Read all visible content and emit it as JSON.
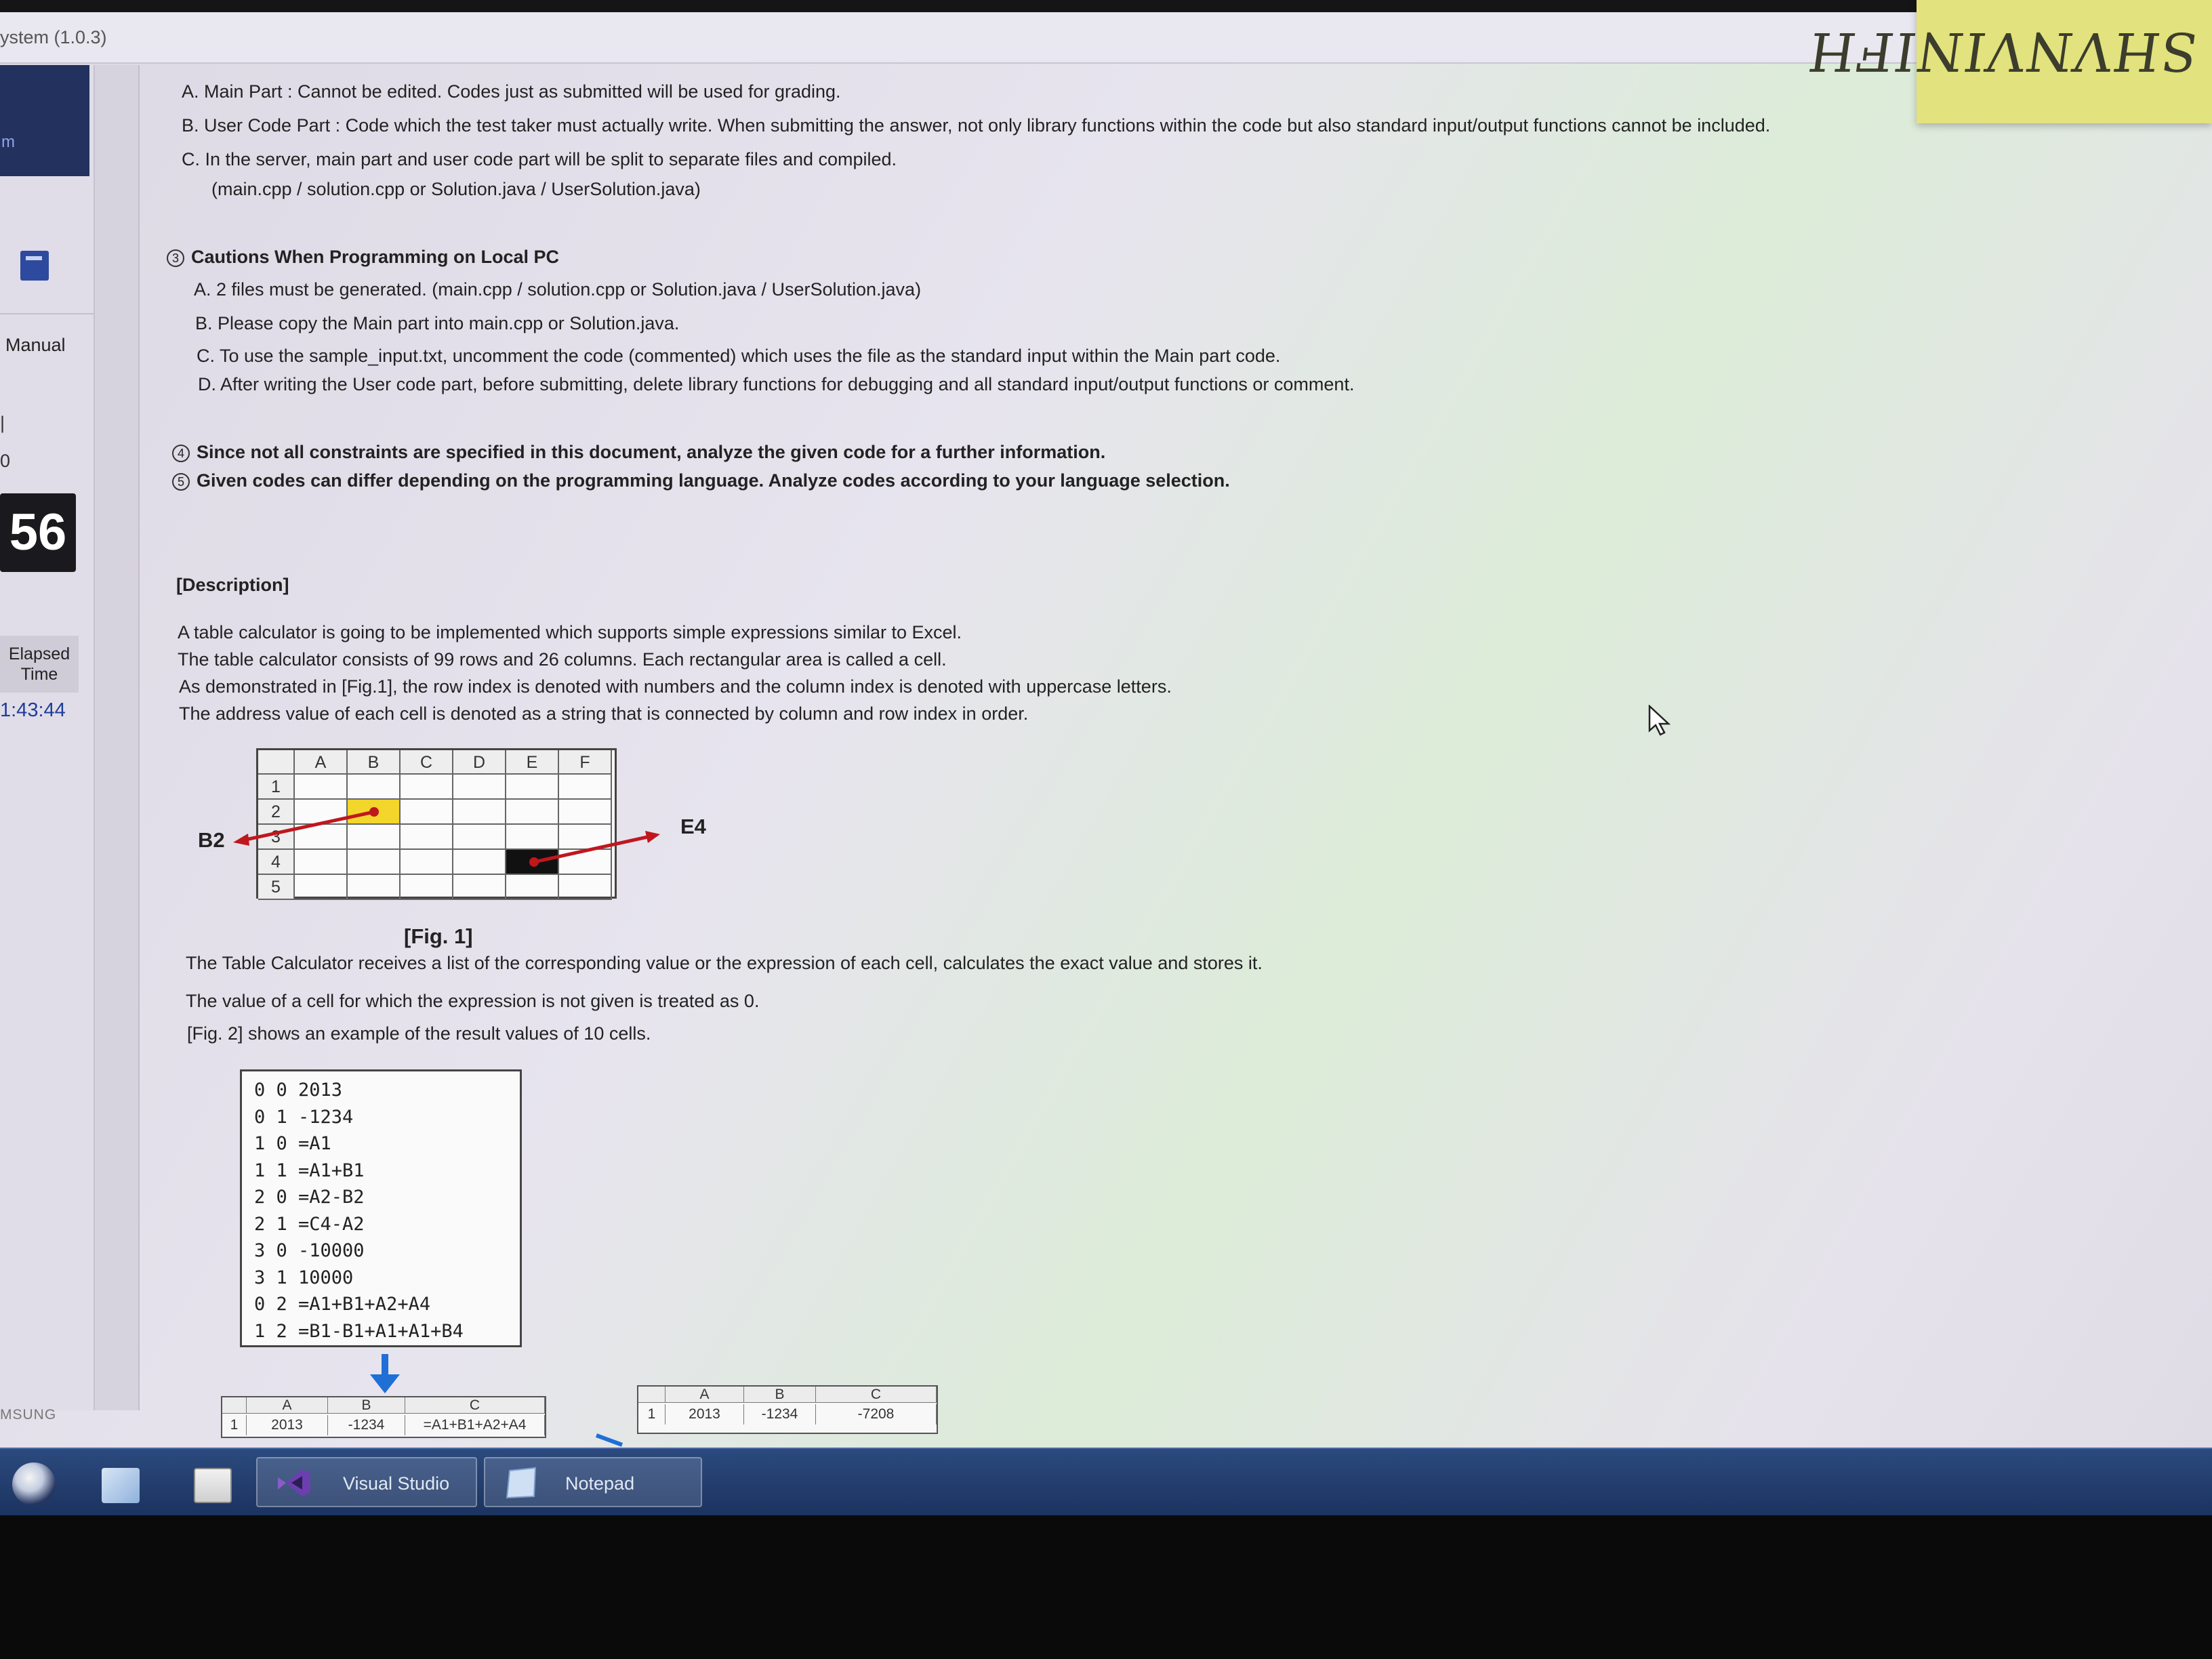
{
  "window": {
    "title": "ystem (1.0.3)"
  },
  "sticky_note": {
    "text": "SHVNVINIFH"
  },
  "sidebar": {
    "nav_fragment": "m",
    "manual_label": "Manual",
    "fragment_1": "|",
    "fragment_2": "0",
    "timer_value": "56",
    "elapsed_label_1": "Elapsed",
    "elapsed_label_2": "Time",
    "elapsed_value": "1:43:44",
    "brand_fragment": "MSUNG"
  },
  "doc": {
    "list_a": "A. Main Part : Cannot be edited. Codes just as submitted will be used for grading.",
    "list_b": "B. User Code Part : Code which the test taker must actually write. When submitting the answer, not only library functions within the code but also standard input/output functions cannot be included.",
    "list_c": "C. In the server, main part and user code part will be split to separate files and compiled.",
    "list_c2": "(main.cpp / solution.cpp or Solution.java / UserSolution.java)",
    "section3_num": "3",
    "section3_title": "Cautions When Programming on Local PC",
    "s3_a": "A. 2 files must be generated. (main.cpp / solution.cpp or Solution.java / UserSolution.java)",
    "s3_b": "B. Please copy the Main part into main.cpp or Solution.java.",
    "s3_c": "C. To use the sample_input.txt, uncomment the code (commented) which uses the file as the standard input within the Main part code.",
    "s3_d": "D. After writing the User code part, before submitting, delete library functions for debugging and all standard input/output functions or comment.",
    "note4_num": "4",
    "note4": "Since not all constraints are specified in this document, analyze the given code for a further information.",
    "note5_num": "5",
    "note5": "Given codes can differ depending on the programming language. Analyze codes according to your language selection.",
    "description_heading": "[Description]",
    "desc_1": "A table calculator is going to be implemented which supports simple expressions similar to Excel.",
    "desc_2": "The table calculator consists of 99 rows and 26 columns. Each rectangular area is called a cell.",
    "desc_3": "As demonstrated in [Fig.1], the row index is denoted with numbers and the column index is denoted with uppercase letters.",
    "desc_4": "The address value of each cell is denoted as a string that is connected by column and row index in order.",
    "fig1": {
      "columns": [
        "A",
        "B",
        "C",
        "D",
        "E",
        "F"
      ],
      "rows": [
        "1",
        "2",
        "3",
        "4",
        "5"
      ],
      "label_left": "B2",
      "label_right": "E4",
      "caption": "[Fig. 1]",
      "highlight_yellow": "B2",
      "highlight_black": "E4",
      "accent_color": "#c0171d",
      "yellow_color": "#f2d62b"
    },
    "after_1": "The Table Calculator receives a list of the corresponding value or the expression of each cell, calculates the exact value and stores it.",
    "after_2": "The value of a cell for which the expression is not given is treated as 0.",
    "after_3": "[Fig. 2] shows an example of the result values of 10 cells.",
    "code_lines": [
      "0 0 2013",
      "0 1 -1234",
      "1 0 =A1",
      "1 1 =A1+B1",
      "2 0 =A2-B2",
      "2 1 =C4-A2",
      "3 0 -10000",
      "3 1 10000",
      "0 2 =A1+B1+A2+A4",
      "1 2 =B1-B1+A1+A1+B4"
    ],
    "table_input": {
      "headers": [
        "A",
        "B",
        "C"
      ],
      "row_num": "1",
      "cells": [
        "2013",
        "-1234",
        "=A1+B1+A2+A4"
      ]
    },
    "table_result": {
      "headers": [
        "A",
        "B",
        "C"
      ],
      "row_num": "1",
      "cells": [
        "2013",
        "-1234",
        "-7208"
      ]
    }
  },
  "taskbar": {
    "items": [
      {
        "label": "Visual Studio"
      },
      {
        "label": "Notepad"
      }
    ]
  }
}
